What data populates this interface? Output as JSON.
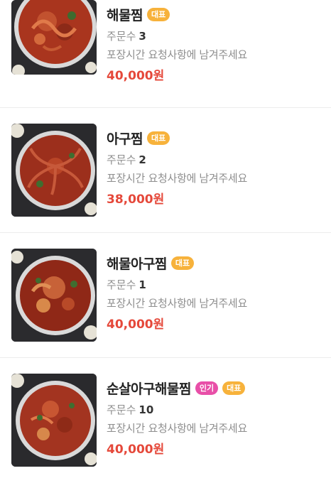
{
  "menu": {
    "orders_label": "주문수",
    "items": [
      {
        "name": "해물찜",
        "badges": [
          {
            "label": "대표",
            "type": "representative",
            "color": "#f7b23b"
          }
        ],
        "orders": "3",
        "note": "포장시간 요청사항에 남겨주세요",
        "price": "40,000원"
      },
      {
        "name": "아구찜",
        "badges": [
          {
            "label": "대표",
            "type": "representative",
            "color": "#f7b23b"
          }
        ],
        "orders": "2",
        "note": "포장시간 요청사항에 남겨주세요",
        "price": "38,000원"
      },
      {
        "name": "해물아구찜",
        "badges": [
          {
            "label": "대표",
            "type": "representative",
            "color": "#f7b23b"
          }
        ],
        "orders": "1",
        "note": "포장시간 요청사항에 남겨주세요",
        "price": "40,000원"
      },
      {
        "name": "순살아구해물찜",
        "badges": [
          {
            "label": "인기",
            "type": "popular",
            "color": "#e84fa8"
          },
          {
            "label": "대표",
            "type": "representative",
            "color": "#f7b23b"
          }
        ],
        "orders": "10",
        "note": "포장시간 요청사항에 남겨주세요",
        "price": "40,000원"
      }
    ]
  },
  "colors": {
    "price": "#e5483a",
    "badge_representative": "#f7b23b",
    "badge_popular": "#e84fa8"
  }
}
